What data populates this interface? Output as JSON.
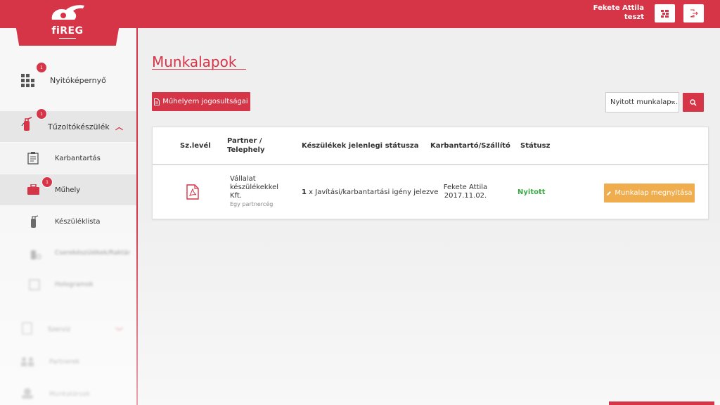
{
  "app": {
    "logo_text": "fiREG"
  },
  "header": {
    "user_name": "Fekete Attila",
    "user_role": "teszt"
  },
  "sidebar": {
    "items": [
      {
        "label": "Nyitóképernyő",
        "badge": "1"
      },
      {
        "label": "Tűzoltókészülék",
        "badge": "1"
      },
      {
        "label": "Karbantartás"
      },
      {
        "label": "Műhely",
        "badge": "1"
      },
      {
        "label": "Készüléklista"
      },
      {
        "label": "Cserekészülékek/Raktár"
      },
      {
        "label": "Hologramok"
      },
      {
        "label": "Szerviz"
      },
      {
        "label": "Partnerek"
      },
      {
        "label": "Munkatársak"
      }
    ]
  },
  "main": {
    "title": "Munkalapok",
    "permissions_button": "Műhelyem jogosultságai",
    "filter_select": "Nyitott munkalap...",
    "table": {
      "headers": {
        "doc": "Sz.levél",
        "partner_1": "Partner /",
        "partner_2": "Telephely",
        "status_now": "Készülékek jelenlegi státusza",
        "maintainer": "Karbantartó/Szállító",
        "status": "Státusz"
      },
      "rows": [
        {
          "partner_line1": "Vállalat",
          "partner_line2": "készülékekkel",
          "partner_line3": "Kft.",
          "site": "Egy partnercég",
          "device_count": "1",
          "device_status": "x Javítási/karbantartási igény jelezve",
          "maintainer_name": "Fekete Attila",
          "maintainer_date": "2017.11.02.",
          "status": "Nyitott",
          "action": "Munkalap megnyitása"
        }
      ]
    }
  },
  "colors": {
    "brand": "#d63447",
    "open_status": "#3aa844",
    "action": "#f0ad4e"
  }
}
